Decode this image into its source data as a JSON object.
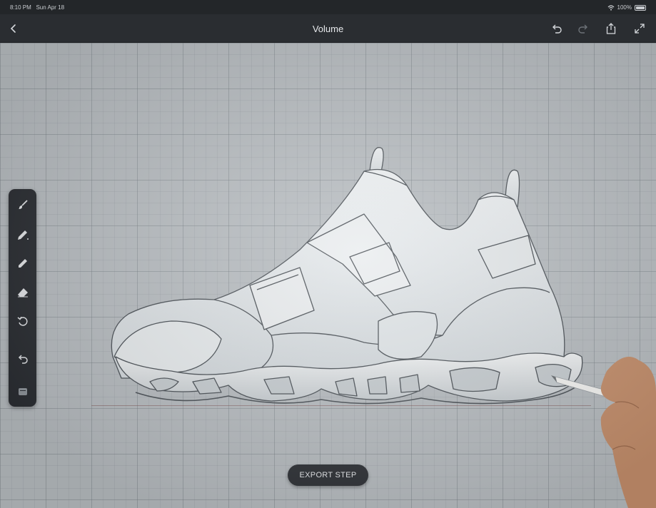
{
  "status_bar": {
    "time": "8:10 PM",
    "date": "Sun Apr 18",
    "battery": "100%"
  },
  "nav": {
    "title": "Volume",
    "icons": [
      "chevron-left-icon",
      "undo-icon",
      "redo-icon",
      "share-icon",
      "expand-icon"
    ]
  },
  "tools": [
    "brush-icon",
    "pen-icon",
    "pencil-icon",
    "eraser-icon",
    "rotate-icon",
    "undo-icon",
    "layers-icon"
  ],
  "export_button": {
    "label": "EXPORT STEP"
  },
  "colors": {
    "canvas": "#b7bcc0",
    "toolbar": "#2b2e33",
    "navbar": "#2a2d31",
    "shoe": "#e4e8ea",
    "outline": "#4a5056"
  }
}
